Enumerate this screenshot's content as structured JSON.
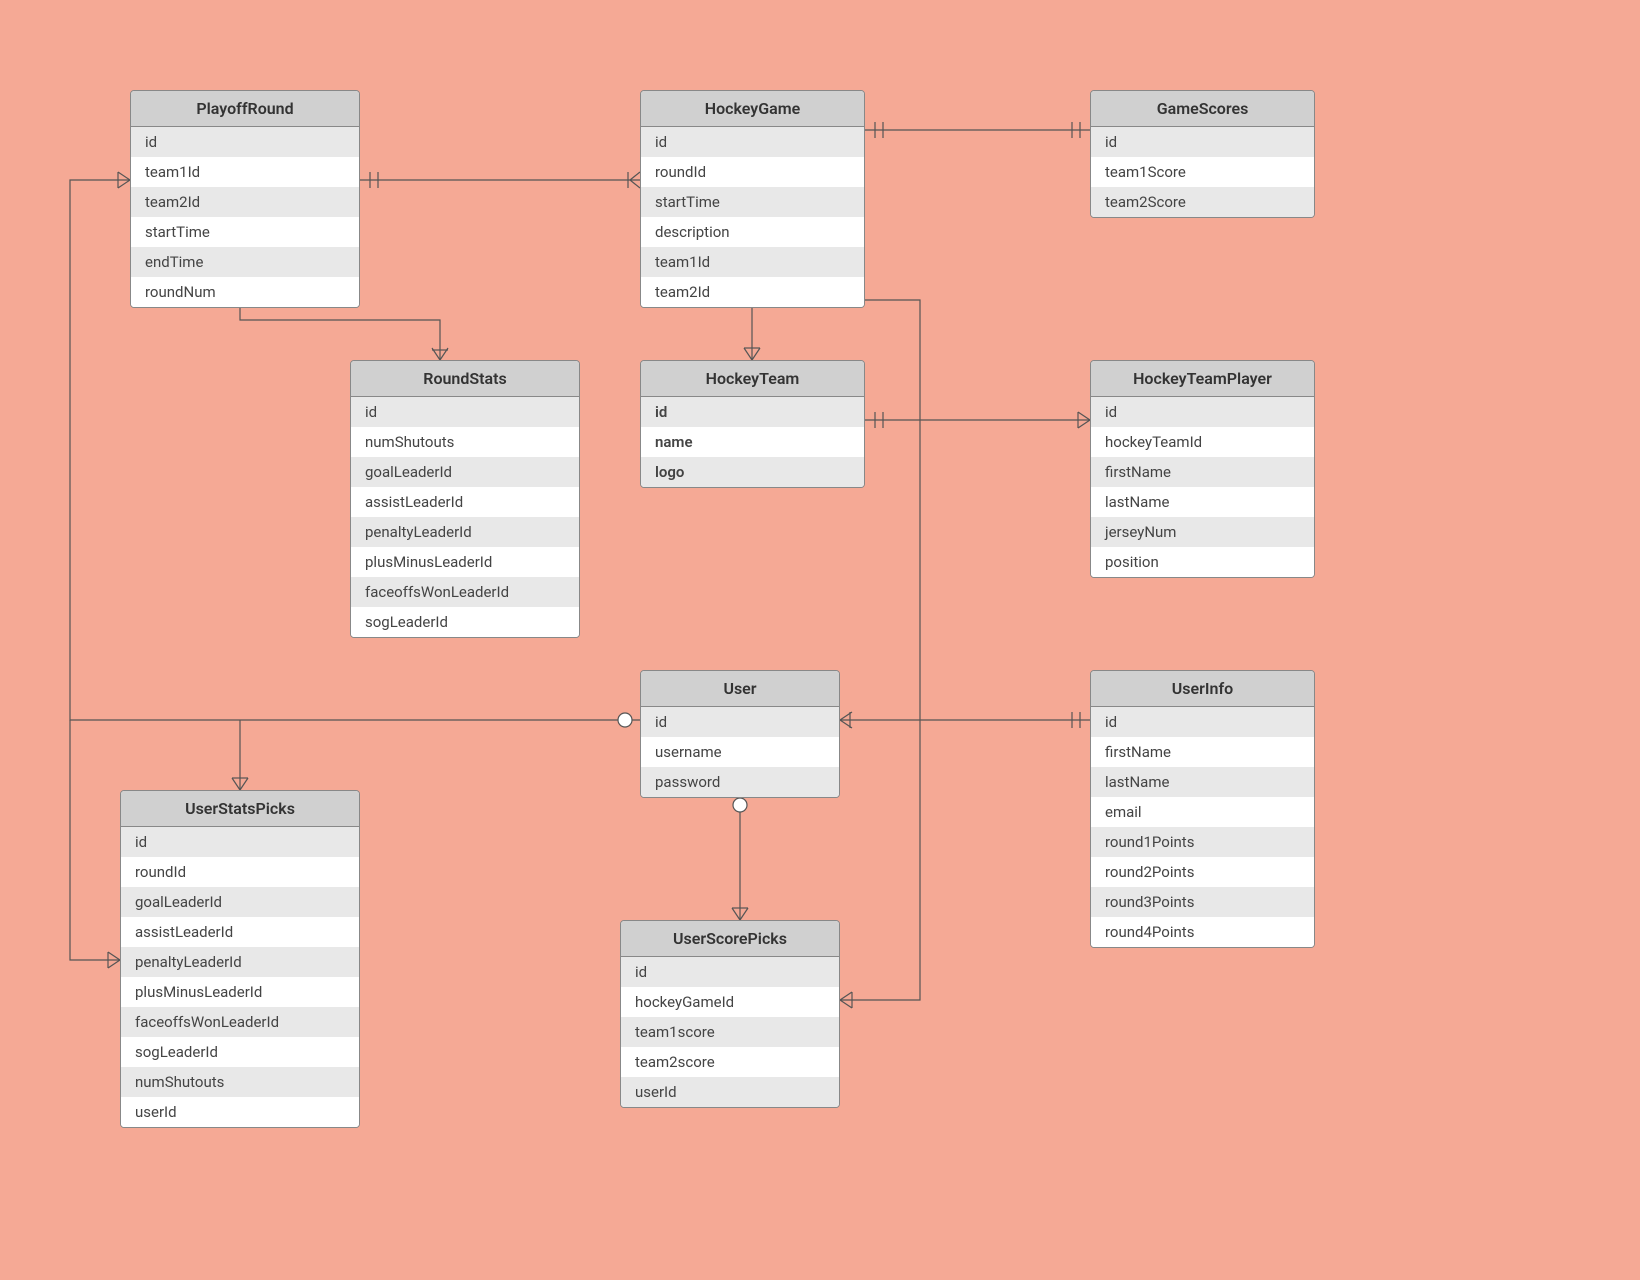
{
  "entities": {
    "playoff_round": {
      "title": "PlayoffRound",
      "fields": [
        "id",
        "team1Id",
        "team2Id",
        "startTime",
        "endTime",
        "roundNum"
      ]
    },
    "hockey_game": {
      "title": "HockeyGame",
      "fields": [
        "id",
        "roundId",
        "startTime",
        "description",
        "team1Id",
        "team2Id"
      ]
    },
    "game_scores": {
      "title": "GameScores",
      "fields": [
        "id",
        "team1Score",
        "team2Score"
      ]
    },
    "round_stats": {
      "title": "RoundStats",
      "fields": [
        "id",
        "numShutouts",
        "goalLeaderId",
        "assistLeaderId",
        "penaltyLeaderId",
        "plusMinusLeaderId",
        "faceoffsWonLeaderId",
        "sogLeaderId"
      ]
    },
    "hockey_team": {
      "title": "HockeyTeam",
      "fields": [
        "id",
        "name",
        "logo"
      ],
      "bold": true
    },
    "hockey_team_player": {
      "title": "HockeyTeamPlayer",
      "fields": [
        "id",
        "hockeyTeamId",
        "firstName",
        "lastName",
        "jerseyNum",
        "position"
      ]
    },
    "user": {
      "title": "User",
      "fields": [
        "id",
        "username",
        "password"
      ]
    },
    "user_info": {
      "title": "UserInfo",
      "fields": [
        "id",
        "firstName",
        "lastName",
        "email",
        "round1Points",
        "round2Points",
        "round3Points",
        "round4Points"
      ]
    },
    "user_stats_picks": {
      "title": "UserStatsPicks",
      "fields": [
        "id",
        "roundId",
        "goalLeaderId",
        "assistLeaderId",
        "penaltyLeaderId",
        "plusMinusLeaderId",
        "faceoffsWonLeaderId",
        "sogLeaderId",
        "numShutouts",
        "userId"
      ]
    },
    "user_score_picks": {
      "title": "UserScorePicks",
      "fields": [
        "id",
        "hockeyGameId",
        "team1score",
        "team2score",
        "userId"
      ]
    }
  }
}
